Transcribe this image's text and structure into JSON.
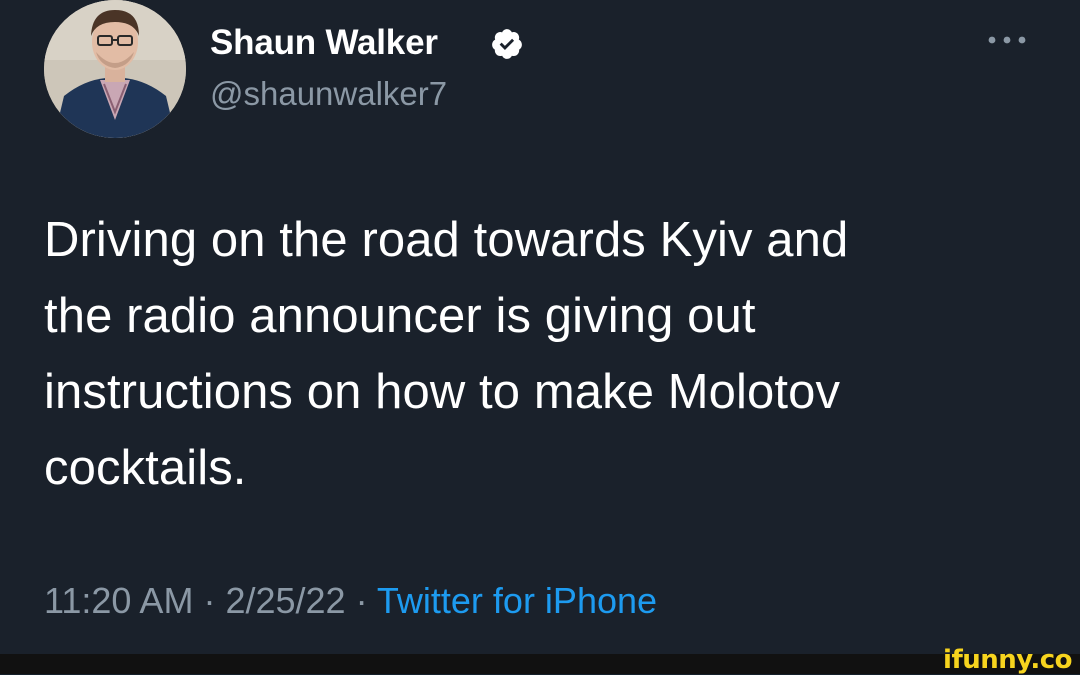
{
  "tweet": {
    "author": {
      "display_name": "Shaun Walker",
      "handle": "@shaunwalker7",
      "verified_icon": "verified-badge-icon",
      "avatar": "profile-photo"
    },
    "more_icon": "more-options-icon",
    "text": "Driving on the road towards Kyiv and\nthe radio announcer is giving out\ninstructions on how to make Molotov\ncocktails.",
    "time": "11:20 AM",
    "separator": " · ",
    "date": "2/25/22",
    "source": "Twitter for iPhone"
  },
  "watermark": {
    "text": "ifunny.co"
  },
  "colors": {
    "background": "#1a212b",
    "secondary_text": "#8b98a5",
    "link": "#1d9bf0",
    "watermark": "#f7d41e"
  }
}
